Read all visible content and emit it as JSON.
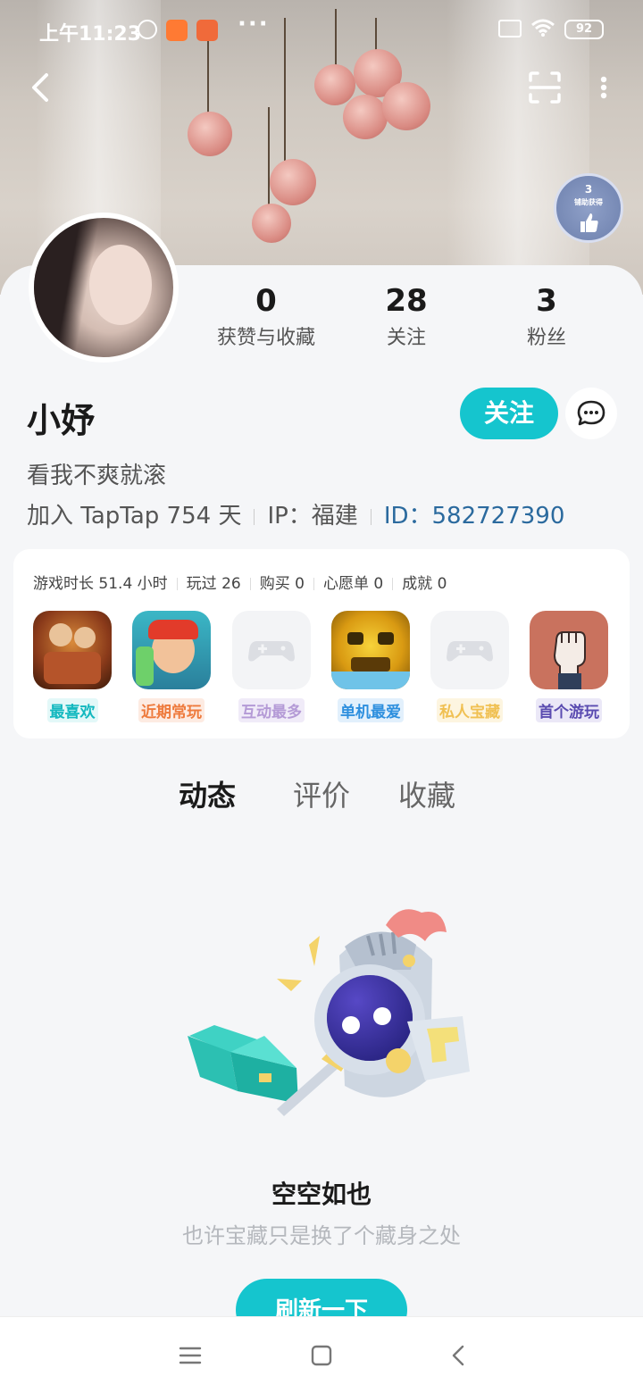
{
  "status_bar": {
    "time": "上午11:23",
    "battery": "92"
  },
  "header": {
    "back_icon": "chevron-left-icon",
    "scan_icon": "scan-icon",
    "more_icon": "more-vertical-icon"
  },
  "medal": {
    "count": "3",
    "caption": "铺助获得"
  },
  "profile": {
    "username": "小妤",
    "bio": "看我不爽就滚",
    "joined": "加入 TapTap 754 天",
    "ip": "IP：福建",
    "id": "ID：582727390",
    "follow_label": "关注"
  },
  "stats": {
    "likes_value": "0",
    "likes_label": "获赞与收藏",
    "following_value": "28",
    "following_label": "关注",
    "fans_value": "3",
    "fans_label": "粉丝"
  },
  "games": {
    "summary": [
      "游戏时长 51.4 小时",
      "玩过 26",
      "购买 0",
      "心愿单 0",
      "成就 0"
    ],
    "items": [
      {
        "tag": "最喜欢",
        "icon": "game-adventure-icon"
      },
      {
        "tag": "近期常玩",
        "icon": "game-subway-surfers-icon"
      },
      {
        "tag": "互动最多",
        "icon": "gamepad-placeholder-icon"
      },
      {
        "tag": "单机最爱",
        "icon": "game-temple-run-icon"
      },
      {
        "tag": "私人宝藏",
        "icon": "gamepad-placeholder-icon"
      },
      {
        "tag": "首个游玩",
        "icon": "game-fist-icon"
      }
    ]
  },
  "tabs": [
    "动态",
    "评价",
    "收藏"
  ],
  "empty_state": {
    "title": "空空如也",
    "subtitle": "也许宝藏只是换了个藏身之处",
    "refresh_label": "刷新一下"
  },
  "colors": {
    "accent": "#15c5ce",
    "id_blue": "#2b6a9e"
  }
}
